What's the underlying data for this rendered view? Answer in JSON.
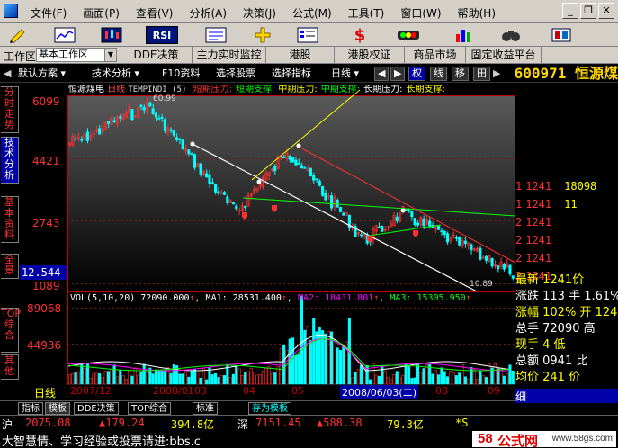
{
  "menubar": {
    "items": [
      "文件(F)",
      "画面(P)",
      "查看(V)",
      "分析(A)",
      "决策(J)",
      "公式(M)",
      "工具(T)",
      "窗口(W)",
      "帮助(H)"
    ]
  },
  "toolbar": {
    "rsi_label": "RSI",
    "dollar_label": "$"
  },
  "tabbar": {
    "workspace_label": "工作区",
    "workspace_value": "基本工作区",
    "tabs": [
      "DDE决策",
      "主力实时监控",
      "港股",
      "港股权证",
      "商品市场",
      "固定收益平台"
    ]
  },
  "chart_toolbar": {
    "default_scheme": "默认方案",
    "tech_analysis": "技术分析",
    "f10": "F10资料",
    "select_stock": "选择股票",
    "select_indicator": "选择指标",
    "period": "日线",
    "quan": "权",
    "xian": "线",
    "yi": "移",
    "grid": "田",
    "stock_code": "600971 恒源煤"
  },
  "vtabs": [
    "分时走势",
    "技术分析",
    "基本资料",
    "全景",
    "TOP综合",
    "其他"
  ],
  "price_chart": {
    "stock_name": "恒源煤电",
    "period": "日线",
    "indicator": "TEMPINDI (5)",
    "legend": [
      {
        "label": "短期压力:",
        "color": "#ff3030"
      },
      {
        "label": "短期支撑:",
        "color": "#00ff00"
      },
      {
        "label": "中期压力:",
        "color": "#ffff00"
      },
      {
        "label": "中期支撑:",
        "color": "#00ff00"
      },
      {
        "label": "长期压力:",
        "color": "#ffffff"
      },
      {
        "label": "长期支撑:",
        "color": "#ffff00"
      }
    ],
    "y_ticks": [
      "6099",
      "4421",
      "2743",
      "1089"
    ],
    "high_label": "60.99",
    "low_label": "10.89",
    "cursor_price": "12.544"
  },
  "volume_chart": {
    "header": "VOL(5,10,20)",
    "vol": "72090.000",
    "ma1_label": "MA1:",
    "ma1": "28531.400",
    "ma2_label": "MA2:",
    "ma2": "18431.801",
    "ma3_label": "MA3:",
    "ma3": "15305.950",
    "y_ticks": [
      "89068",
      "44936"
    ],
    "x_ticks": [
      "2007/12",
      "2008/01",
      "03",
      "04",
      "05",
      "2008/06/03(二)",
      "08",
      "09"
    ],
    "period_label": "日线"
  },
  "right_panel": {
    "book_rows": [
      {
        "idx": "1",
        "price": "1241",
        "vol": "18098"
      },
      {
        "idx": "1",
        "price": "1241",
        "vol": "11"
      },
      {
        "idx": "2",
        "price": "1241",
        "vol": ""
      },
      {
        "idx": "2",
        "price": "1241",
        "vol": ""
      },
      {
        "idx": "2",
        "price": "1241",
        "vol": ""
      },
      {
        "idx": "2",
        "price": "1241",
        "vol": ""
      }
    ],
    "quote_rows": [
      "最新 1241价",
      "涨跌 113 手 1.61%",
      "涨幅 102% 开 1241",
      "总手 72090 高",
      "现手 4 低",
      "总额 0941 比",
      "均价 241 价"
    ],
    "footer": "细"
  },
  "bottom_tabs": [
    "指标",
    "模板",
    "DDE决策",
    "TOP综合",
    "标准",
    "存为模板"
  ],
  "ticker": {
    "sh_label": "沪",
    "sh_value": "2075.08",
    "sh_change": "▲179.24",
    "sh_amount": "394.8亿",
    "sz_label": "深",
    "sz_value": "7151.45",
    "sz_change": "▲588.38",
    "sz_amount": "79.3亿",
    "extra": "*S"
  },
  "statusbar": {
    "scroll_text": "大智慧情、学习经验或投票请进:bbs.c",
    "logo_num": "58",
    "logo_text": "公式网",
    "logo_url": "www.58gs.com"
  },
  "colors": {
    "up": "#ff3030",
    "down": "#00ffff",
    "yellow": "#ffff00",
    "green": "#00ff00",
    "magenta": "#ff00ff",
    "accent_blue": "#0000a8"
  },
  "chart_data": {
    "type": "candlestick",
    "y_axis_ticks": [
      6099,
      4421,
      2743,
      1089
    ],
    "ylim": [
      1089,
      6099
    ],
    "high": 60.99,
    "low": 10.89,
    "volume_ticks": [
      89068,
      44936
    ]
  }
}
